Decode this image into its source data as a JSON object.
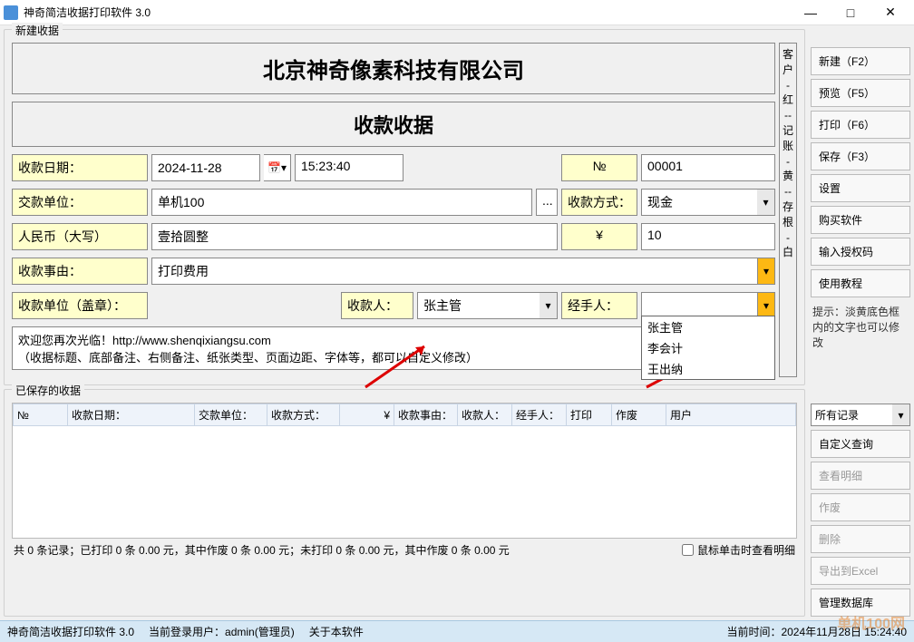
{
  "window": {
    "title": "神奇简洁收据打印软件 3.0"
  },
  "groupbox": {
    "new_receipt": "新建收据",
    "saved_receipt": "已保存的收据"
  },
  "receipt": {
    "company_name": "北京神奇像素科技有限公司",
    "receipt_title": "收款收据",
    "date_label": "收款日期：",
    "date_value": "2024-11-28",
    "time_value": "15:23:40",
    "no_label": "№",
    "no_value": "00001",
    "payer_label": "交款单位：",
    "payer_value": "单机100",
    "payer_btn": "...",
    "pay_method_label": "收款方式：",
    "pay_method_value": "现金",
    "rmb_label": "人民币（大写）",
    "rmb_upper": "壹拾圆整",
    "currency_symbol": "¥",
    "amount": "10",
    "reason_label": "收款事由：",
    "reason_value": "打印费用",
    "unit_seal_label": "收款单位（盖章）：",
    "payee_label": "收款人：",
    "payee_value": "张主管",
    "handler_label": "经手人：",
    "handler_value": "",
    "note_line1": "欢迎您再次光临！http://www.shenqixiangsu.com",
    "note_line2": "（收据标题、底部备注、右侧备注、纸张类型、页面边距、字体等，都可以自定义修改）",
    "side_note": "客户 - 红 -- 记账 - 黄 -- 存根 - 白"
  },
  "handler_dropdown": {
    "opt1": "张主管",
    "opt2": "李会计",
    "opt3": "王出纳"
  },
  "buttons": {
    "new": "新建（F2）",
    "preview": "预览（F5）",
    "print": "打印（F6）",
    "save": "保存（F3）",
    "settings": "设置",
    "buy": "购买软件",
    "auth": "输入授权码",
    "tutorial": "使用教程",
    "all_records": "所有记录",
    "custom_query": "自定义查询",
    "view_detail": "查看明细",
    "void": "作废",
    "delete": "删除",
    "export": "导出到Excel",
    "manage_db": "管理数据库"
  },
  "hint": "提示：淡黄底色框内的文字也可以修改",
  "table": {
    "headers": {
      "no": "№",
      "date": "收款日期：",
      "payer": "交款单位：",
      "method": "收款方式：",
      "amount": "¥",
      "reason": "收款事由：",
      "payee": "收款人：",
      "handler": "经手人：",
      "print": "打印",
      "void": "作废",
      "user": "用户"
    }
  },
  "status_summary": "共 0 条记录；已打印 0 条 0.00 元，其中作废 0 条 0.00 元；未打印 0 条 0.00 元，其中作废 0 条 0.00 元",
  "click_detail": "鼠标单击时查看明细",
  "bottombar": {
    "app": "神奇简洁收据打印软件 3.0",
    "user": "当前登录用户：admin(管理员)",
    "about": "关于本软件",
    "time": "当前时间：2024年11月28日 15:24:40"
  },
  "watermark": "单机100网"
}
